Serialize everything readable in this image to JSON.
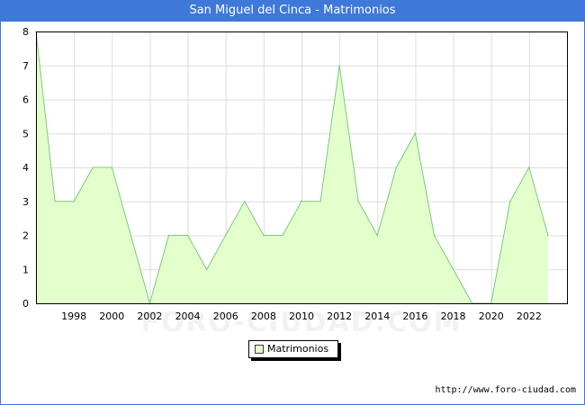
{
  "title": "San Miguel del Cinca - Matrimonios",
  "credit": "http://www.foro-ciudad.com",
  "watermark": "FORO-CIUDAD.COM",
  "colors": {
    "titlebar": "#3e78d8",
    "area_fill": "#e3ffcc",
    "area_line": "#7cc97c",
    "grid": "#dddddd"
  },
  "chart_data": {
    "type": "area",
    "title": "San Miguel del Cinca - Matrimonios",
    "x": [
      1996,
      1997,
      1998,
      1999,
      2000,
      2001,
      2002,
      2003,
      2004,
      2005,
      2006,
      2007,
      2008,
      2009,
      2010,
      2011,
      2012,
      2013,
      2014,
      2015,
      2016,
      2017,
      2018,
      2019,
      2020,
      2021,
      2022,
      2023
    ],
    "series": [
      {
        "name": "Matrimonios",
        "values": [
          8,
          3,
          3,
          4,
          4,
          2,
          0,
          2,
          2,
          1,
          2,
          3,
          2,
          2,
          3,
          3,
          7,
          3,
          2,
          4,
          5,
          2,
          1,
          0,
          0,
          3,
          4,
          2
        ]
      }
    ],
    "xticks": [
      "1998",
      "2000",
      "2002",
      "2004",
      "2006",
      "2008",
      "2010",
      "2012",
      "2014",
      "2016",
      "2018",
      "2020",
      "2022"
    ],
    "yticks": [
      "0",
      "1",
      "2",
      "3",
      "4",
      "5",
      "6",
      "7",
      "8"
    ],
    "xlim": [
      1996,
      2024
    ],
    "ylim": [
      0,
      8
    ],
    "grid": true,
    "legend": "bottom-center"
  }
}
